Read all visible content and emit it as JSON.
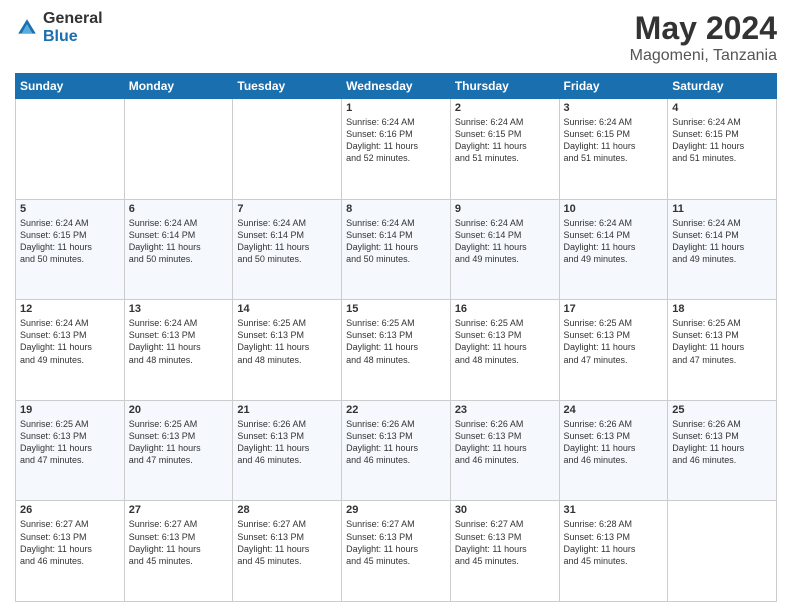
{
  "logo": {
    "general": "General",
    "blue": "Blue"
  },
  "title": {
    "month_year": "May 2024",
    "location": "Magomeni, Tanzania"
  },
  "header_days": [
    "Sunday",
    "Monday",
    "Tuesday",
    "Wednesday",
    "Thursday",
    "Friday",
    "Saturday"
  ],
  "weeks": [
    [
      {
        "day": "",
        "info": ""
      },
      {
        "day": "",
        "info": ""
      },
      {
        "day": "",
        "info": ""
      },
      {
        "day": "1",
        "info": "Sunrise: 6:24 AM\nSunset: 6:16 PM\nDaylight: 11 hours\nand 52 minutes."
      },
      {
        "day": "2",
        "info": "Sunrise: 6:24 AM\nSunset: 6:15 PM\nDaylight: 11 hours\nand 51 minutes."
      },
      {
        "day": "3",
        "info": "Sunrise: 6:24 AM\nSunset: 6:15 PM\nDaylight: 11 hours\nand 51 minutes."
      },
      {
        "day": "4",
        "info": "Sunrise: 6:24 AM\nSunset: 6:15 PM\nDaylight: 11 hours\nand 51 minutes."
      }
    ],
    [
      {
        "day": "5",
        "info": "Sunrise: 6:24 AM\nSunset: 6:15 PM\nDaylight: 11 hours\nand 50 minutes."
      },
      {
        "day": "6",
        "info": "Sunrise: 6:24 AM\nSunset: 6:14 PM\nDaylight: 11 hours\nand 50 minutes."
      },
      {
        "day": "7",
        "info": "Sunrise: 6:24 AM\nSunset: 6:14 PM\nDaylight: 11 hours\nand 50 minutes."
      },
      {
        "day": "8",
        "info": "Sunrise: 6:24 AM\nSunset: 6:14 PM\nDaylight: 11 hours\nand 50 minutes."
      },
      {
        "day": "9",
        "info": "Sunrise: 6:24 AM\nSunset: 6:14 PM\nDaylight: 11 hours\nand 49 minutes."
      },
      {
        "day": "10",
        "info": "Sunrise: 6:24 AM\nSunset: 6:14 PM\nDaylight: 11 hours\nand 49 minutes."
      },
      {
        "day": "11",
        "info": "Sunrise: 6:24 AM\nSunset: 6:14 PM\nDaylight: 11 hours\nand 49 minutes."
      }
    ],
    [
      {
        "day": "12",
        "info": "Sunrise: 6:24 AM\nSunset: 6:13 PM\nDaylight: 11 hours\nand 49 minutes."
      },
      {
        "day": "13",
        "info": "Sunrise: 6:24 AM\nSunset: 6:13 PM\nDaylight: 11 hours\nand 48 minutes."
      },
      {
        "day": "14",
        "info": "Sunrise: 6:25 AM\nSunset: 6:13 PM\nDaylight: 11 hours\nand 48 minutes."
      },
      {
        "day": "15",
        "info": "Sunrise: 6:25 AM\nSunset: 6:13 PM\nDaylight: 11 hours\nand 48 minutes."
      },
      {
        "day": "16",
        "info": "Sunrise: 6:25 AM\nSunset: 6:13 PM\nDaylight: 11 hours\nand 48 minutes."
      },
      {
        "day": "17",
        "info": "Sunrise: 6:25 AM\nSunset: 6:13 PM\nDaylight: 11 hours\nand 47 minutes."
      },
      {
        "day": "18",
        "info": "Sunrise: 6:25 AM\nSunset: 6:13 PM\nDaylight: 11 hours\nand 47 minutes."
      }
    ],
    [
      {
        "day": "19",
        "info": "Sunrise: 6:25 AM\nSunset: 6:13 PM\nDaylight: 11 hours\nand 47 minutes."
      },
      {
        "day": "20",
        "info": "Sunrise: 6:25 AM\nSunset: 6:13 PM\nDaylight: 11 hours\nand 47 minutes."
      },
      {
        "day": "21",
        "info": "Sunrise: 6:26 AM\nSunset: 6:13 PM\nDaylight: 11 hours\nand 46 minutes."
      },
      {
        "day": "22",
        "info": "Sunrise: 6:26 AM\nSunset: 6:13 PM\nDaylight: 11 hours\nand 46 minutes."
      },
      {
        "day": "23",
        "info": "Sunrise: 6:26 AM\nSunset: 6:13 PM\nDaylight: 11 hours\nand 46 minutes."
      },
      {
        "day": "24",
        "info": "Sunrise: 6:26 AM\nSunset: 6:13 PM\nDaylight: 11 hours\nand 46 minutes."
      },
      {
        "day": "25",
        "info": "Sunrise: 6:26 AM\nSunset: 6:13 PM\nDaylight: 11 hours\nand 46 minutes."
      }
    ],
    [
      {
        "day": "26",
        "info": "Sunrise: 6:27 AM\nSunset: 6:13 PM\nDaylight: 11 hours\nand 46 minutes."
      },
      {
        "day": "27",
        "info": "Sunrise: 6:27 AM\nSunset: 6:13 PM\nDaylight: 11 hours\nand 45 minutes."
      },
      {
        "day": "28",
        "info": "Sunrise: 6:27 AM\nSunset: 6:13 PM\nDaylight: 11 hours\nand 45 minutes."
      },
      {
        "day": "29",
        "info": "Sunrise: 6:27 AM\nSunset: 6:13 PM\nDaylight: 11 hours\nand 45 minutes."
      },
      {
        "day": "30",
        "info": "Sunrise: 6:27 AM\nSunset: 6:13 PM\nDaylight: 11 hours\nand 45 minutes."
      },
      {
        "day": "31",
        "info": "Sunrise: 6:28 AM\nSunset: 6:13 PM\nDaylight: 11 hours\nand 45 minutes."
      },
      {
        "day": "",
        "info": ""
      }
    ]
  ]
}
